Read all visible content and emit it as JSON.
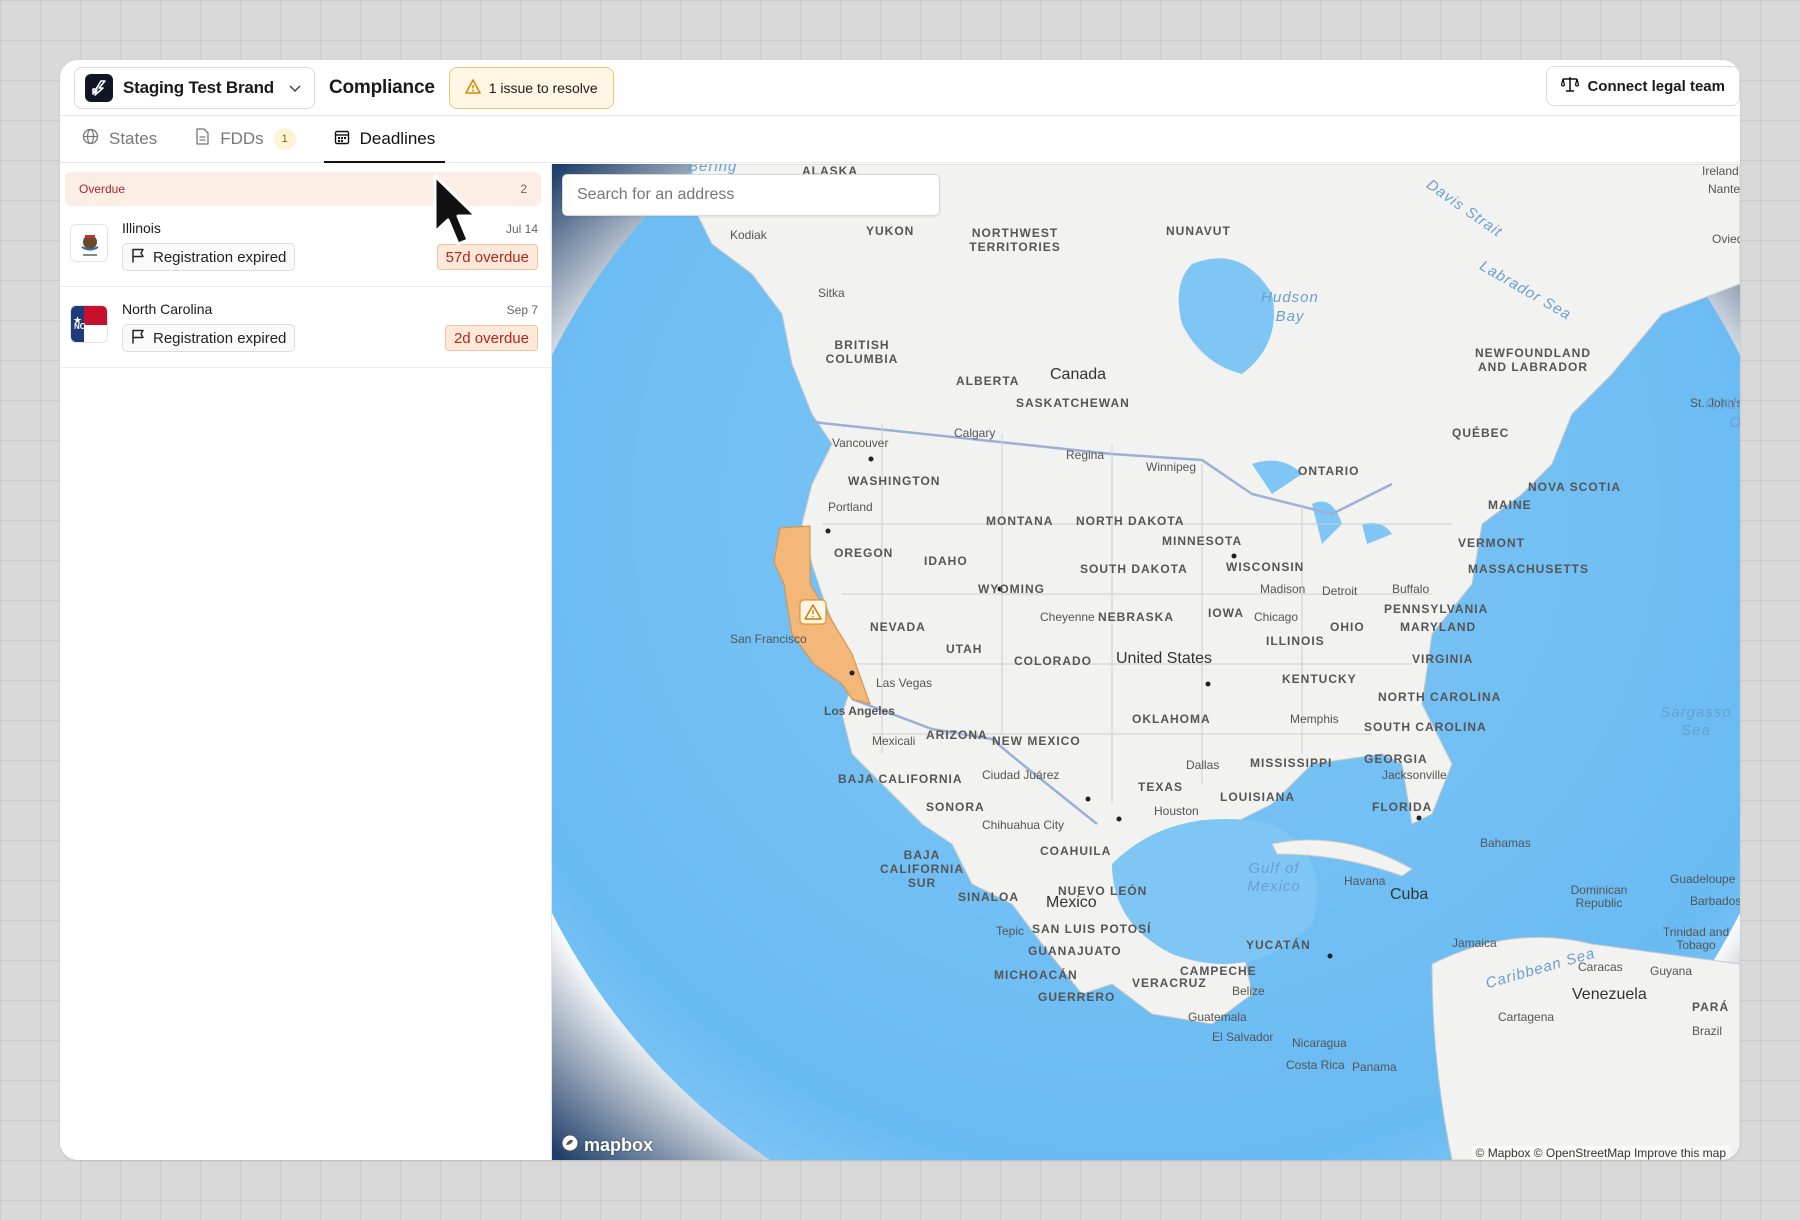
{
  "header": {
    "brand": "Staging Test Brand",
    "title": "Compliance",
    "issue_badge": "1 issue to resolve",
    "legal_button": "Connect legal team"
  },
  "tabs": [
    {
      "label": "States",
      "icon": "globe-icon"
    },
    {
      "label": "FDDs",
      "icon": "document-icon",
      "count": "1"
    },
    {
      "label": "Deadlines",
      "icon": "calendar-icon",
      "active": true
    }
  ],
  "deadlines": {
    "group_label": "Overdue",
    "group_count": "2",
    "items": [
      {
        "state": "Illinois",
        "date": "Jul 14",
        "status": "Registration expired",
        "overdue": "57d overdue"
      },
      {
        "state": "North Carolina",
        "date": "Sep 7",
        "status": "Registration expired",
        "overdue": "2d overdue"
      }
    ]
  },
  "map": {
    "search_placeholder": "Search for an address",
    "logo_text": "mapbox",
    "attribution": "© Mapbox © OpenStreetMap Improve this map",
    "highlight_color": "#f3b77a",
    "labels": {
      "alaska": "ALASKA",
      "kodiak": "Kodiak",
      "yukon": "YUKON",
      "nwt": "NORTHWEST TERRITORIES",
      "nunavut": "NUNAVUT",
      "hudson": "Hudson Bay",
      "sitka": "Sitka",
      "bc": "BRITISH COLUMBIA",
      "alberta": "ALBERTA",
      "canada": "Canada",
      "sask": "SASKATCHEWAN",
      "newfoundland": "NEWFOUNDLAND AND LABRADOR",
      "stjohns": "St. John's",
      "quebec": "QUÉBEC",
      "vancouver": "Vancouver",
      "calgary": "Calgary",
      "regina": "Regina",
      "winnipeg": "Winnipeg",
      "ontario": "ONTARIO",
      "washington": "WASHINGTON",
      "portland": "Portland",
      "oregon": "OREGON",
      "idaho": "IDAHO",
      "montana": "MONTANA",
      "north_dakota": "NORTH DAKOTA",
      "minnesota": "MINNESOTA",
      "wisconsin": "WISCONSIN",
      "maine": "MAINE",
      "nova_scotia": "NOVA SCOTIA",
      "vermont": "VERMONT",
      "massachusetts": "MASSACHUSETTS",
      "south_dakota": "SOUTH DAKOTA",
      "wyoming": "WYOMING",
      "madison": "Madison",
      "detroit": "Detroit",
      "buffalo": "Buffalo",
      "pennsylvania": "PENNSYLVANIA",
      "nevada": "NEVADA",
      "san_francisco": "San Francisco",
      "cheyenne": "Cheyenne",
      "nebraska": "NEBRASKA",
      "iowa": "IOWA",
      "chicago": "Chicago",
      "ohio": "OHIO",
      "maryland": "MARYLAND",
      "utah": "UTAH",
      "colorado": "COLORADO",
      "united_states": "United States",
      "illinois": "ILLINOIS",
      "virginia": "VIRGINIA",
      "las_vegas": "Las Vegas",
      "kentucky": "KENTUCKY",
      "north_carolina": "NORTH CAROLINA",
      "los_angeles": "Los Angeles",
      "oklahoma": "OKLAHOMA",
      "memphis": "Memphis",
      "south_carolina": "SOUTH CAROLINA",
      "arizona": "ARIZONA",
      "new_mexico": "NEW MEXICO",
      "mexicali": "Mexicali",
      "dallas": "Dallas",
      "mississippi": "MISSISSIPPI",
      "georgia": "GEORGIA",
      "ciudad_juarez": "Ciudad Juárez",
      "baja_california": "BAJA CALIFORNIA",
      "texas": "TEXAS",
      "louisiana": "LOUISIANA",
      "jacksonville": "Jacksonville",
      "sonora": "SONORA",
      "houston": "Houston",
      "florida": "FLORIDA",
      "chihuahua_city": "Chihuahua City",
      "sargasso": "Sargasso Sea",
      "baja_sur": "BAJA CALIFORNIA SUR",
      "coahuila": "COAHUILA",
      "bahamas": "Bahamas",
      "gulf": "Gulf of Mexico",
      "havana": "Havana",
      "guadeloupe": "Guadeloupe",
      "nuevo_leon": "NUEVO LEÓN",
      "sinaloa": "SINALOA",
      "cuba": "Cuba",
      "dominican": "Dominican Republic",
      "barbados": "Barbados",
      "mexico": "Mexico",
      "tepic": "Tepic",
      "slp": "SAN LUIS POTOSÍ",
      "jamaica": "Jamaica",
      "trinidad": "Trinidad and Tobago",
      "yucatan": "YUCATÁN",
      "guanajuato": "GUANAJUATO",
      "caribbean": "Caribbean Sea",
      "caracas": "Caracas",
      "guyana": "Guyana",
      "michoacan": "MICHOACÁN",
      "campeche": "CAMPECHE",
      "veracruz": "VERACRUZ",
      "guerrero": "GUERRERO",
      "belize": "Belize",
      "venezuela": "Venezuela",
      "guatemala": "Guatemala",
      "cartagena": "Cartagena",
      "para": "PARÁ",
      "el_salvador": "El Salvador",
      "nicaragua": "Nicaragua",
      "brazil": "Brazil",
      "costa_rica": "Costa Rica",
      "panama": "Panama",
      "davis": "Davis Strait",
      "labrador": "Labrador Sea",
      "ireland": "Ireland",
      "nantes": "Nantes",
      "oviedo": "Oviedo",
      "bering": "Bering",
      "north_atlantic": "N Atl O"
    }
  }
}
